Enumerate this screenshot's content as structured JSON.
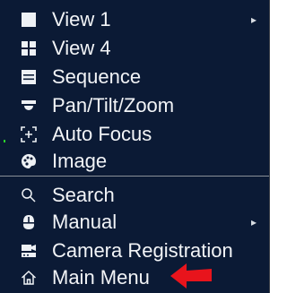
{
  "menu": {
    "items": [
      {
        "label": "View 1",
        "icon": "square-icon",
        "submenu": true
      },
      {
        "label": "View 4",
        "icon": "grid-4-icon",
        "submenu": false
      },
      {
        "label": "Sequence",
        "icon": "sequence-icon",
        "submenu": false
      },
      {
        "label": "Pan/Tilt/Zoom",
        "icon": "ptz-camera-icon",
        "submenu": false
      },
      {
        "label": "Auto Focus",
        "icon": "auto-focus-icon",
        "submenu": false
      },
      {
        "label": "Image",
        "icon": "palette-icon",
        "submenu": false
      },
      {
        "label": "Search",
        "icon": "search-icon",
        "submenu": false
      },
      {
        "label": "Manual",
        "icon": "manual-icon",
        "submenu": true
      },
      {
        "label": "Camera Registration",
        "icon": "camera-registration-icon",
        "submenu": false
      },
      {
        "label": "Main Menu",
        "icon": "home-icon",
        "submenu": false
      }
    ],
    "submenu_arrow": "▸"
  },
  "colors": {
    "menu_background": "#0b1a35",
    "text": "#f2f4f7",
    "separator": "#8a8f98",
    "annotation_arrow": "#e8141c"
  },
  "annotation": {
    "icon": "red-arrow-icon"
  }
}
